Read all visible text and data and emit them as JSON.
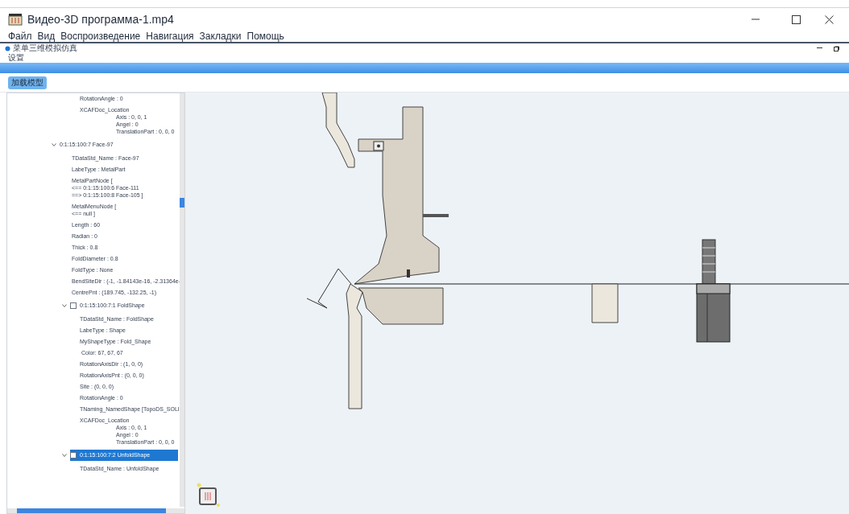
{
  "window": {
    "title": "Видео-3D программа-1.mp4"
  },
  "menu": [
    "Файл",
    "Вид",
    "Воспроизведение",
    "Навигация",
    "Закладки",
    "Помощь"
  ],
  "app": {
    "title": "菜单三维模拟仿真",
    "settings": "设置",
    "load_button": "加载模型"
  },
  "tree": {
    "orphan_items": [
      {
        "lines": [
          "RotationAngle : 0"
        ]
      },
      {
        "lines": [
          "XCAFDoc_Location"
        ],
        "sub_lines": [
          "Axis : 0, 0, 1",
          "Angel : 0",
          "TranslationPart : 0, 0, 0"
        ]
      }
    ],
    "nodes": [
      {
        "label": "0:1:15:100:7 Face-97",
        "expanded": true,
        "selected": false,
        "children": [
          {
            "lines": [
              "TDataStd_Name : Face-97"
            ]
          },
          {
            "lines": [
              "LabeType : MetalPart"
            ]
          },
          {
            "lines": [
              "MetalPartNode [",
              "<== 0:1:15:100:6 Face-111",
              "==> 0:1:15:100:8 Face-105 ]"
            ]
          },
          {
            "lines": [
              "MetalMenuNode [",
              "<== null ]"
            ]
          },
          {
            "lines": [
              "Length : 60"
            ]
          },
          {
            "lines": [
              "Radian : 0"
            ]
          },
          {
            "lines": [
              "Thick : 0.8"
            ]
          },
          {
            "lines": [
              "FoldDiameter : 0.8"
            ]
          },
          {
            "lines": [
              "FoldType : None"
            ]
          },
          {
            "lines": [
              "BendSiteDir : (-1, -1.84143e-16, -2.31364e-"
            ]
          },
          {
            "lines": [
              "CentrePnt : (189.745, -132.25, -1)"
            ]
          },
          {
            "label": "0:1:15:100:7:1 FoldShape",
            "expanded": true,
            "checked": false,
            "selected": false,
            "children": [
              {
                "lines": [
                  "TDataStd_Name : FoldShape"
                ]
              },
              {
                "lines": [
                  "LabeType : Shape"
                ]
              },
              {
                "lines": [
                  "MyShapeType : Fold_Shape"
                ]
              },
              {
                "lines": [
                  " Color: 67, 67, 67"
                ]
              },
              {
                "lines": [
                  "RotationAxisDir : (1, 0, 0)"
                ]
              },
              {
                "lines": [
                  "RotationAxisPnt : (0, 0, 0)"
                ]
              },
              {
                "lines": [
                  "Site : (0, 0, 0)"
                ]
              },
              {
                "lines": [
                  "RotationAngle : 0"
                ]
              },
              {
                "lines": [
                  "TNaming_NamedShape [TopoDS_SOLI"
                ]
              },
              {
                "lines": [
                  "XCAFDoc_Location"
                ],
                "sub_lines": [
                  "Axis : 0, 0, 1",
                  "Angel : 0",
                  "TranslationPart : 0, 0, 0"
                ]
              }
            ]
          },
          {
            "label": "0:1:15:100:7:2 UnfoldShape",
            "expanded": true,
            "checked": false,
            "selected": true,
            "children": [
              {
                "lines": [
                  "TDataStd_Name : UnfoldShape"
                ]
              }
            ]
          }
        ]
      }
    ]
  }
}
